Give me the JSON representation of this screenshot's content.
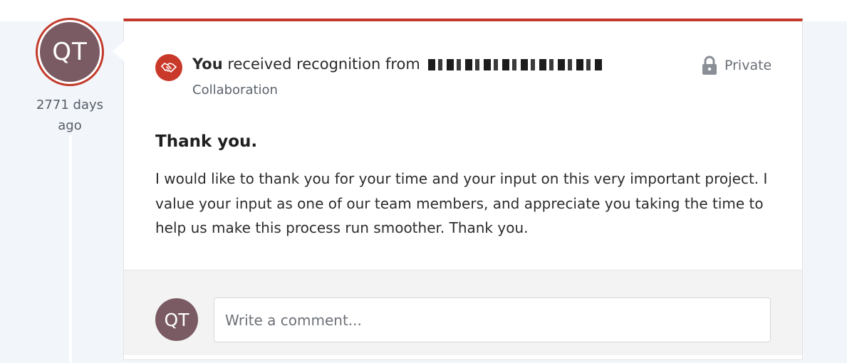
{
  "sender": {
    "initials": "QT",
    "time_ago": "2771 days ago"
  },
  "recognition": {
    "subject": "You",
    "headline_text": "received recognition from",
    "category": "Collaboration",
    "visibility_label": "Private",
    "icon": "handshake-icon",
    "accent_color": "#c33a2c"
  },
  "message": {
    "title": "Thank you.",
    "body": "I would like to thank you for your time and your input on this very important project. I value your input as one of our team members, and appreciate you taking the time to help us make this process run smoother. Thank you."
  },
  "comment": {
    "initials": "QT",
    "placeholder": "Write a comment..."
  }
}
